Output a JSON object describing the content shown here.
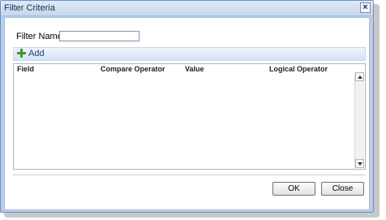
{
  "window": {
    "title": "Filter Criteria",
    "close_glyph": "×"
  },
  "form": {
    "filter_name_label": "Filter Name:",
    "filter_name_value": "",
    "filter_name_placeholder": ""
  },
  "toolbar": {
    "add_label": "Add",
    "add_icon": "plus-icon",
    "add_icon_color": "#3c9a2c"
  },
  "grid": {
    "columns": [
      "Field",
      "Compare Operator",
      "Value",
      "Logical Operator"
    ],
    "rows": []
  },
  "buttons": {
    "ok": "OK",
    "close": "Close"
  },
  "colors": {
    "window_frame": "#b8cde9",
    "toolbar": "#d3e2f5",
    "link_text": "#15428b"
  }
}
